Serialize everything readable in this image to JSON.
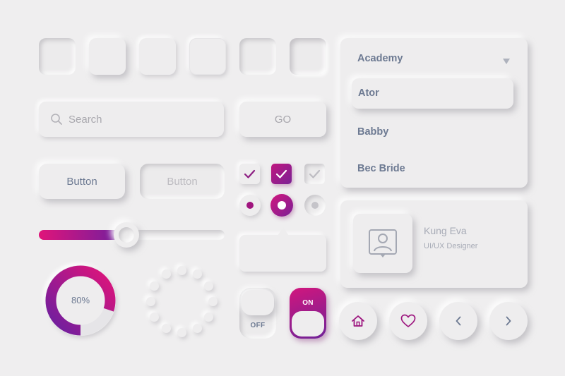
{
  "search": {
    "placeholder": "Search",
    "go_label": "GO",
    "icon": "search-icon"
  },
  "buttons": {
    "primary_label": "Button",
    "disabled_label": "Button"
  },
  "checkboxes": [
    {
      "checked": true,
      "style": "neutral"
    },
    {
      "checked": true,
      "style": "accent"
    },
    {
      "checked": true,
      "style": "disabled"
    }
  ],
  "radios": [
    {
      "selected": true,
      "style": "neutral"
    },
    {
      "selected": true,
      "style": "accent"
    },
    {
      "selected": true,
      "style": "disabled"
    }
  ],
  "slider": {
    "value_fraction": 0.47
  },
  "progress": {
    "label": "80%",
    "value": 80
  },
  "dropdown": {
    "selected": "Academy",
    "caret_icon": "triangle-down-icon",
    "options": [
      "Ator",
      "Babby",
      "Bec Bride"
    ]
  },
  "profile": {
    "name": "Kung Eva",
    "role": "UI/UX Designer",
    "icon": "user-portrait-icon"
  },
  "toggles": {
    "off_label": "OFF",
    "on_label": "ON"
  },
  "nav": {
    "icons": [
      "home-icon",
      "heart-icon",
      "chevron-left-icon",
      "chevron-right-icon"
    ]
  },
  "colors": {
    "accent_start": "#e0147a",
    "accent_end": "#6a1fa0",
    "background": "#efeeef",
    "text": "#6d7a92"
  }
}
